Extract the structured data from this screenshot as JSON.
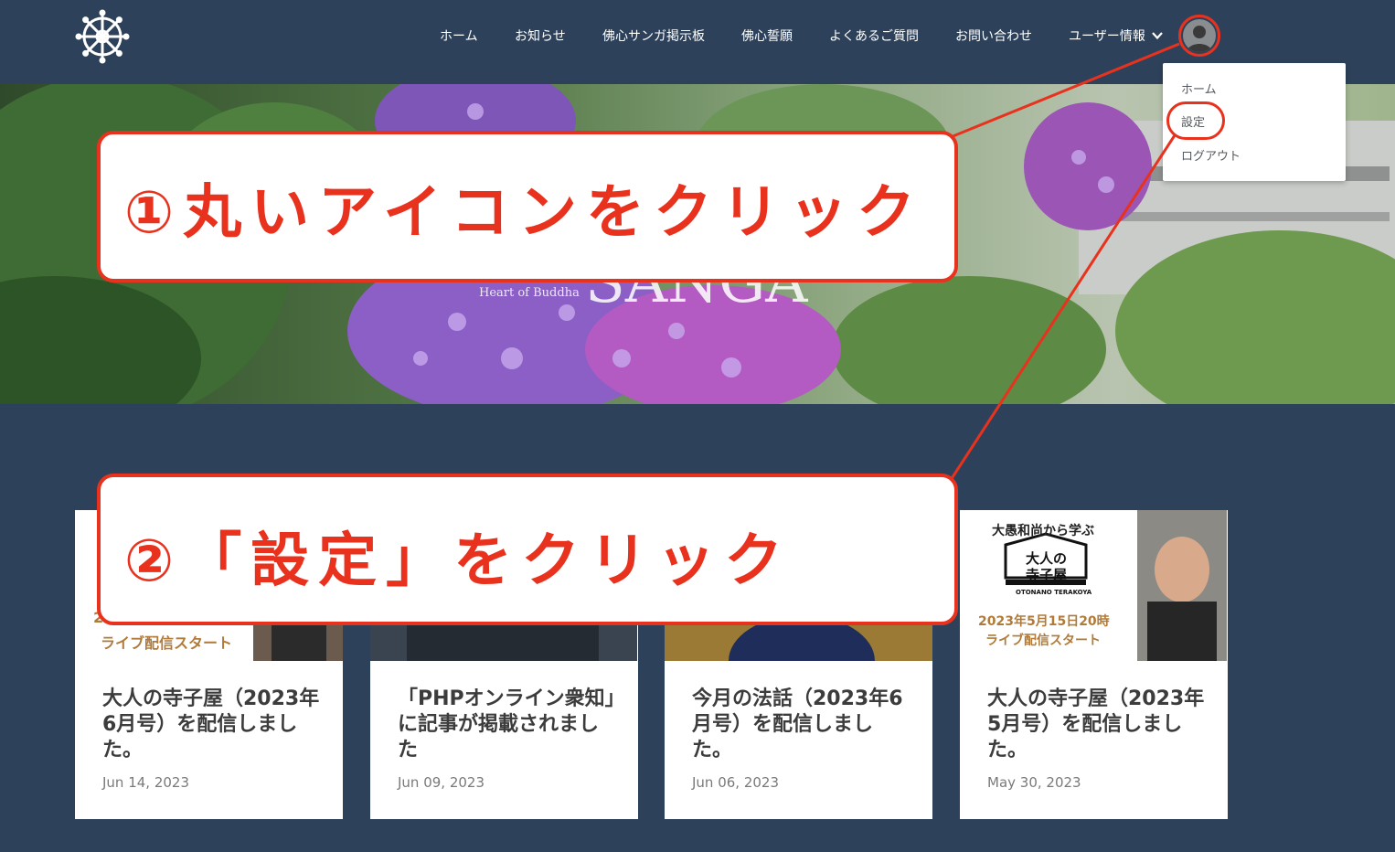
{
  "header": {
    "nav": [
      {
        "label": "ホーム"
      },
      {
        "label": "お知らせ"
      },
      {
        "label": "佛心サンガ掲示板"
      },
      {
        "label": "佛心誓願"
      },
      {
        "label": "よくあるご質問"
      },
      {
        "label": "お問い合わせ"
      },
      {
        "label": "ユーザー情報"
      }
    ]
  },
  "dropdown": {
    "items": [
      {
        "label": "ホーム"
      },
      {
        "label": "設定"
      },
      {
        "label": "ログアウト"
      }
    ]
  },
  "hero": {
    "title": "SANGA",
    "seal_text": "Heart of Buddha"
  },
  "annotations": {
    "step1": "①丸いアイコンをクリック",
    "step2": "②「設定」をクリック"
  },
  "cards": [
    {
      "title": "大人の寺子屋（2023年6月号）を配信しました。",
      "date": "Jun 14, 2023",
      "thumb_line1": "20",
      "thumb_line2": "ライブ配信スタート"
    },
    {
      "title": "「PHPオンライン衆知」に記事が掲載されました",
      "date": "Jun 09, 2023"
    },
    {
      "title": "今月の法話（2023年6月号）を配信しました。",
      "date": "Jun 06, 2023"
    },
    {
      "title": "大人の寺子屋（2023年5月号）を配信しました。",
      "date": "May 30, 2023",
      "thumb_heading": "大愚和尚から学ぶ",
      "thumb_logo_line1": "大人の",
      "thumb_logo_line2": "寺子屋",
      "thumb_logo_sub": "OTONANO TERAKOYA",
      "thumb_line1": "2023年5月15日20時",
      "thumb_line2": "ライブ配信スタート"
    }
  ],
  "colors": {
    "header_bg": "#2d425a",
    "accent_red": "#e8321e",
    "card_text": "#3c3c3c"
  },
  "icons": {
    "logo": "dharma-wheel-icon",
    "avatar": "user-silhouette-icon",
    "chevron": "chevron-down-icon"
  }
}
